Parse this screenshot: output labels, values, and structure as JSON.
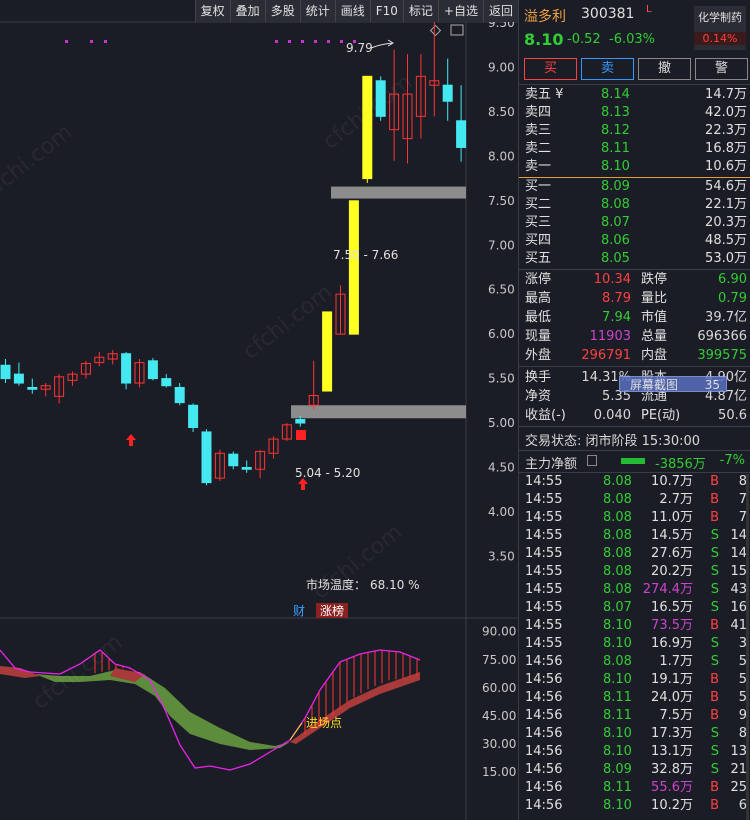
{
  "toolbar": [
    "复权",
    "叠加",
    "多股",
    "统计",
    "画线",
    "F10",
    "标记",
    "+自选",
    "返回"
  ],
  "stock": {
    "name": "溢多利",
    "code": "300381",
    "flag": "L",
    "price": "8.10",
    "change": "-0.52",
    "pct": "-6.03%",
    "industry": "化学制药",
    "industry_pct": "0.14%"
  },
  "trade_buttons": [
    "买",
    "卖",
    "撤",
    "警"
  ],
  "asks": [
    {
      "label": "卖五 ¥",
      "price": "8.14",
      "vol": "14.7万"
    },
    {
      "label": "卖四",
      "price": "8.13",
      "vol": "42.0万"
    },
    {
      "label": "卖三",
      "price": "8.12",
      "vol": "22.3万"
    },
    {
      "label": "卖二",
      "price": "8.11",
      "vol": "16.8万"
    },
    {
      "label": "卖一",
      "price": "8.10",
      "vol": "10.6万"
    }
  ],
  "bids": [
    {
      "label": "买一",
      "price": "8.09",
      "vol": "54.6万"
    },
    {
      "label": "买二",
      "price": "8.08",
      "vol": "22.1万"
    },
    {
      "label": "买三",
      "price": "8.07",
      "vol": "20.3万"
    },
    {
      "label": "买四",
      "price": "8.06",
      "vol": "48.5万"
    },
    {
      "label": "买五",
      "price": "8.05",
      "vol": "53.0万"
    }
  ],
  "stats": [
    {
      "l1": "涨停",
      "v1": "10.34",
      "c1": "red",
      "l2": "跌停",
      "v2": "6.90",
      "c2": "green"
    },
    {
      "l1": "最高",
      "v1": "8.79",
      "c1": "red",
      "l2": "量比",
      "v2": "0.79",
      "c2": "green"
    },
    {
      "l1": "最低",
      "v1": "7.94",
      "c1": "green",
      "l2": "市值",
      "v2": "39.7亿",
      "c2": ""
    },
    {
      "l1": "现量",
      "v1": "11903",
      "c1": "mag",
      "l2": "总量",
      "v2": "696366",
      "c2": ""
    },
    {
      "l1": "外盘",
      "v1": "296791",
      "c1": "red",
      "l2": "内盘",
      "v2": "399575",
      "c2": "green"
    }
  ],
  "stats2": [
    {
      "l1": "换手",
      "v1": "14.31%",
      "l2": "股本",
      "v2": "4.90亿"
    },
    {
      "l1": "净资",
      "v1": "5.35",
      "l2": "流通",
      "v2": "4.87亿"
    },
    {
      "l1": "收益(-)",
      "v1": "0.040",
      "l2": "PE(动)",
      "v2": "50.6"
    }
  ],
  "screenshot_tip": {
    "label": "屏幕截图",
    "num": "35"
  },
  "trade_status": "交易状态: 闭市阶段 15:30:00",
  "main_flow": {
    "label": "主力净额",
    "value": "-3856万",
    "pct": "-7%"
  },
  "ticks": [
    {
      "t": "14:55",
      "p": "8.08",
      "v": "10.7万",
      "bs": "B",
      "n": "8",
      "vc": ""
    },
    {
      "t": "14:55",
      "p": "8.08",
      "v": "2.7万",
      "bs": "B",
      "n": "7",
      "vc": ""
    },
    {
      "t": "14:55",
      "p": "8.08",
      "v": "11.0万",
      "bs": "B",
      "n": "7",
      "vc": ""
    },
    {
      "t": "14:55",
      "p": "8.08",
      "v": "14.5万",
      "bs": "S",
      "n": "14",
      "vc": ""
    },
    {
      "t": "14:55",
      "p": "8.08",
      "v": "27.6万",
      "bs": "S",
      "n": "14",
      "vc": ""
    },
    {
      "t": "14:55",
      "p": "8.08",
      "v": "20.2万",
      "bs": "S",
      "n": "15",
      "vc": ""
    },
    {
      "t": "14:55",
      "p": "8.08",
      "v": "274.4万",
      "bs": "S",
      "n": "43",
      "vc": "mag"
    },
    {
      "t": "14:55",
      "p": "8.07",
      "v": "16.5万",
      "bs": "S",
      "n": "16",
      "vc": ""
    },
    {
      "t": "14:55",
      "p": "8.10",
      "v": "73.5万",
      "bs": "B",
      "n": "41",
      "vc": "mag"
    },
    {
      "t": "14:55",
      "p": "8.10",
      "v": "16.9万",
      "bs": "S",
      "n": "3",
      "vc": ""
    },
    {
      "t": "14:56",
      "p": "8.08",
      "v": "1.7万",
      "bs": "S",
      "n": "5",
      "vc": ""
    },
    {
      "t": "14:56",
      "p": "8.10",
      "v": "19.1万",
      "bs": "B",
      "n": "5",
      "vc": ""
    },
    {
      "t": "14:56",
      "p": "8.11",
      "v": "24.0万",
      "bs": "B",
      "n": "5",
      "vc": ""
    },
    {
      "t": "14:56",
      "p": "8.11",
      "v": "7.5万",
      "bs": "B",
      "n": "9",
      "vc": ""
    },
    {
      "t": "14:56",
      "p": "8.10",
      "v": "17.3万",
      "bs": "S",
      "n": "8",
      "vc": ""
    },
    {
      "t": "14:56",
      "p": "8.10",
      "v": "13.1万",
      "bs": "S",
      "n": "13",
      "vc": ""
    },
    {
      "t": "14:56",
      "p": "8.09",
      "v": "32.8万",
      "bs": "S",
      "n": "21",
      "vc": ""
    },
    {
      "t": "14:56",
      "p": "8.11",
      "v": "55.6万",
      "bs": "B",
      "n": "25",
      "vc": "mag"
    },
    {
      "t": "14:56",
      "p": "8.10",
      "v": "10.2万",
      "bs": "B",
      "n": "6",
      "vc": ""
    }
  ],
  "chart_data": {
    "type": "candlestick",
    "price_axis": [
      "9.50",
      "9.00",
      "8.50",
      "8.00",
      "7.50",
      "7.00",
      "6.50",
      "6.00",
      "5.50",
      "5.00",
      "4.50",
      "4.00",
      "3.50"
    ],
    "indicator_axis": [
      "90.00",
      "75.00",
      "60.00",
      "45.00",
      "30.00",
      "15.00"
    ],
    "candles": [
      {
        "o": 5.65,
        "h": 5.72,
        "l": 5.45,
        "c": 5.5,
        "color": "cyan"
      },
      {
        "o": 5.55,
        "h": 5.68,
        "l": 5.42,
        "c": 5.45,
        "color": "cyan"
      },
      {
        "o": 5.4,
        "h": 5.5,
        "l": 5.33,
        "c": 5.38,
        "color": "cyan"
      },
      {
        "o": 5.38,
        "h": 5.45,
        "l": 5.3,
        "c": 5.42,
        "color": "red"
      },
      {
        "o": 5.3,
        "h": 5.55,
        "l": 5.22,
        "c": 5.52,
        "color": "red"
      },
      {
        "o": 5.48,
        "h": 5.58,
        "l": 5.42,
        "c": 5.55,
        "color": "red"
      },
      {
        "o": 5.55,
        "h": 5.7,
        "l": 5.5,
        "c": 5.67,
        "color": "red"
      },
      {
        "o": 5.68,
        "h": 5.8,
        "l": 5.64,
        "c": 5.74,
        "color": "red"
      },
      {
        "o": 5.72,
        "h": 5.82,
        "l": 5.66,
        "c": 5.78,
        "color": "red"
      },
      {
        "o": 5.78,
        "h": 5.8,
        "l": 5.38,
        "c": 5.45,
        "color": "cyan"
      },
      {
        "o": 5.45,
        "h": 5.72,
        "l": 5.4,
        "c": 5.68,
        "color": "red"
      },
      {
        "o": 5.7,
        "h": 5.73,
        "l": 5.48,
        "c": 5.5,
        "color": "cyan"
      },
      {
        "o": 5.5,
        "h": 5.55,
        "l": 5.4,
        "c": 5.42,
        "color": "cyan"
      },
      {
        "o": 5.4,
        "h": 5.45,
        "l": 5.2,
        "c": 5.23,
        "color": "cyan"
      },
      {
        "o": 5.2,
        "h": 5.22,
        "l": 4.9,
        "c": 4.95,
        "color": "cyan"
      },
      {
        "o": 4.9,
        "h": 4.93,
        "l": 4.3,
        "c": 4.33,
        "color": "cyan"
      },
      {
        "o": 4.38,
        "h": 4.7,
        "l": 4.35,
        "c": 4.66,
        "color": "red"
      },
      {
        "o": 4.65,
        "h": 4.68,
        "l": 4.48,
        "c": 4.52,
        "color": "cyan"
      },
      {
        "o": 4.5,
        "h": 4.58,
        "l": 4.44,
        "c": 4.48,
        "color": "cyan"
      },
      {
        "o": 4.48,
        "h": 4.7,
        "l": 4.38,
        "c": 4.68,
        "color": "red"
      },
      {
        "o": 4.66,
        "h": 4.85,
        "l": 4.6,
        "c": 4.82,
        "color": "red"
      },
      {
        "o": 4.82,
        "h": 5.0,
        "l": 4.8,
        "c": 4.98,
        "color": "red"
      },
      {
        "o": 5.0,
        "h": 5.08,
        "l": 4.96,
        "c": 5.04,
        "color": "cyan"
      },
      {
        "o": 5.2,
        "h": 5.7,
        "l": 5.15,
        "c": 5.31,
        "color": "red"
      },
      {
        "o": 5.36,
        "h": 6.25,
        "l": 5.36,
        "c": 6.25,
        "color": "yellow"
      },
      {
        "o": 6.0,
        "h": 6.55,
        "l": 6.0,
        "c": 6.45,
        "color": "red"
      },
      {
        "o": 6.0,
        "h": 7.5,
        "l": 6.0,
        "c": 7.5,
        "color": "yellow"
      },
      {
        "o": 7.75,
        "h": 8.9,
        "l": 7.7,
        "c": 8.9,
        "color": "yellow"
      },
      {
        "o": 8.45,
        "h": 8.9,
        "l": 8.4,
        "c": 8.85,
        "color": "cyan"
      },
      {
        "o": 8.3,
        "h": 9.2,
        "l": 7.95,
        "c": 8.7,
        "color": "red"
      },
      {
        "o": 8.2,
        "h": 9.15,
        "l": 7.92,
        "c": 8.7,
        "color": "red"
      },
      {
        "o": 8.45,
        "h": 9.15,
        "l": 8.2,
        "c": 8.9,
        "color": "red"
      },
      {
        "o": 8.85,
        "h": 9.79,
        "l": 8.45,
        "c": 8.8,
        "color": "red"
      },
      {
        "o": 8.8,
        "h": 9.1,
        "l": 8.4,
        "c": 8.62,
        "color": "cyan"
      },
      {
        "o": 8.4,
        "h": 8.8,
        "l": 7.94,
        "c": 8.1,
        "color": "cyan"
      }
    ],
    "annotations": {
      "high_label": "9.79",
      "zone1_label": "7.50 - 7.66",
      "zone2_label": "5.04 - 5.20",
      "market_temp_label": "市场温度：",
      "market_temp_value": "68.10 %",
      "entry_label": "进场点",
      "badge_cai": "财",
      "badge_zhangbang": "涨榜"
    }
  }
}
